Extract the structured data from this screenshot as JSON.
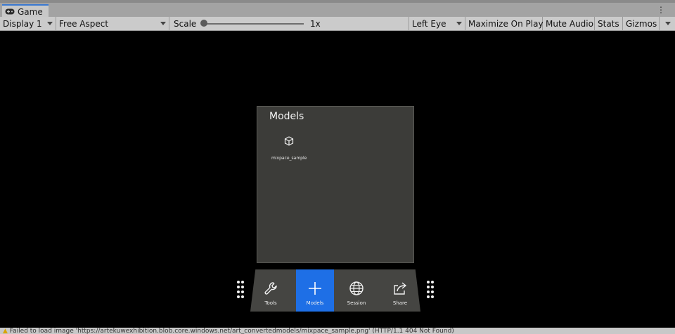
{
  "window": {
    "tab_label": "Game",
    "tab_icon": "gamepad-icon",
    "menu_icon": "kebab-menu-icon"
  },
  "toolbar": {
    "display": "Display 1",
    "aspect": "Free Aspect",
    "scale_label": "Scale",
    "scale_value": "1x",
    "eye": "Left Eye",
    "maximize": "Maximize On Play",
    "mute": "Mute Audio",
    "stats": "Stats",
    "gizmos": "Gizmos"
  },
  "panel": {
    "title": "Models",
    "items": [
      {
        "label": "mixpace_sample",
        "icon": "cube-icon"
      }
    ]
  },
  "dock": {
    "buttons": [
      {
        "label": "Tools",
        "icon": "wrench-icon"
      },
      {
        "label": "Models",
        "icon": "plus-icon",
        "active": true
      },
      {
        "label": "Session",
        "icon": "globe-icon"
      },
      {
        "label": "Share",
        "icon": "share-icon"
      }
    ],
    "active_color": "#1e6fe6"
  },
  "status": {
    "message": "Failed to load image 'https://artekuwexhibition.blob.core.windows.net/art_convertedmodels/mixpace_sample.png' (HTTP/1.1 404 Not Found)",
    "icon": "warning-icon"
  }
}
